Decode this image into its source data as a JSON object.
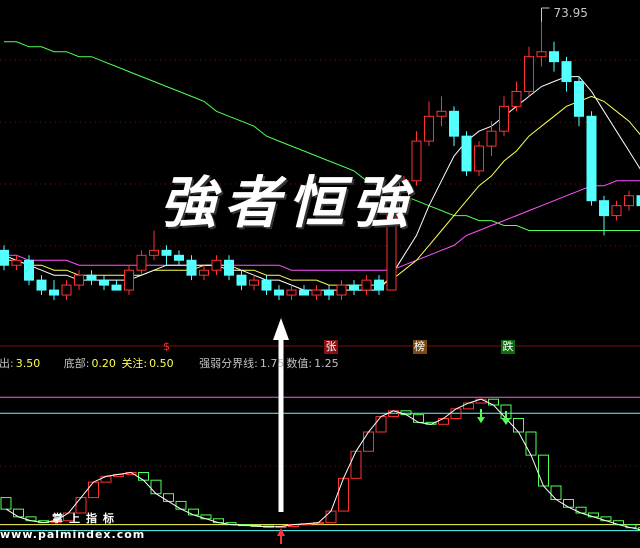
{
  "price_max_label": "73.95",
  "slogan": "強者恒強",
  "badges": {
    "dollar": "$",
    "rise": "张",
    "rank": "榜",
    "fall": "跌"
  },
  "indicator_bar": {
    "sell_label": "卖出:",
    "sell_value": "3.50",
    "bottom_label": "底部:",
    "bottom_value": "0.20",
    "watch_label": "关注:",
    "watch_value": "0.50",
    "boundary_label": "强弱分界线:",
    "boundary_value": "1.75",
    "value_label": "数值:",
    "value_value": "1.25"
  },
  "watermark": {
    "logo": "掌上指标",
    "url": "www.palmindex.com"
  },
  "colors": {
    "up": "#ff3232",
    "down": "#54ffff",
    "ma_white": "#ffffff",
    "ma_yellow": "#ffff54",
    "ma_magenta": "#ff54ff",
    "ma_green": "#54ff54",
    "ind_up": "#ff3232",
    "ind_down": "#54ff54",
    "ind_mid": "#ffffff"
  },
  "chart_data": {
    "type": "candlestick",
    "price_range": [
      18,
      76
    ],
    "candles": [
      {
        "o": 28,
        "c": 25,
        "h": 29,
        "l": 24
      },
      {
        "o": 25,
        "c": 26,
        "h": 27,
        "l": 24
      },
      {
        "o": 26,
        "c": 22,
        "h": 27,
        "l": 21
      },
      {
        "o": 22,
        "c": 20,
        "h": 23,
        "l": 19
      },
      {
        "o": 20,
        "c": 19,
        "h": 22,
        "l": 18
      },
      {
        "o": 19,
        "c": 21,
        "h": 22,
        "l": 18
      },
      {
        "o": 21,
        "c": 23,
        "h": 24,
        "l": 20
      },
      {
        "o": 23,
        "c": 22,
        "h": 24,
        "l": 21
      },
      {
        "o": 22,
        "c": 21,
        "h": 23,
        "l": 20
      },
      {
        "o": 21,
        "c": 20,
        "h": 22,
        "l": 20
      },
      {
        "o": 20,
        "c": 24,
        "h": 25,
        "l": 19
      },
      {
        "o": 24,
        "c": 27,
        "h": 28,
        "l": 23
      },
      {
        "o": 27,
        "c": 28,
        "h": 32,
        "l": 26
      },
      {
        "o": 28,
        "c": 27,
        "h": 29,
        "l": 25
      },
      {
        "o": 27,
        "c": 26,
        "h": 28,
        "l": 25
      },
      {
        "o": 26,
        "c": 23,
        "h": 27,
        "l": 22
      },
      {
        "o": 23,
        "c": 24,
        "h": 25,
        "l": 22
      },
      {
        "o": 24,
        "c": 26,
        "h": 27,
        "l": 23
      },
      {
        "o": 26,
        "c": 23,
        "h": 27,
        "l": 22
      },
      {
        "o": 23,
        "c": 21,
        "h": 24,
        "l": 20
      },
      {
        "o": 21,
        "c": 22,
        "h": 23,
        "l": 20
      },
      {
        "o": 22,
        "c": 20,
        "h": 23,
        "l": 19
      },
      {
        "o": 20,
        "c": 19,
        "h": 21,
        "l": 18
      },
      {
        "o": 19,
        "c": 20,
        "h": 21,
        "l": 18
      },
      {
        "o": 20,
        "c": 19,
        "h": 21,
        "l": 19
      },
      {
        "o": 19,
        "c": 20,
        "h": 21,
        "l": 18
      },
      {
        "o": 20,
        "c": 19,
        "h": 21,
        "l": 18
      },
      {
        "o": 19,
        "c": 21,
        "h": 22,
        "l": 18
      },
      {
        "o": 21,
        "c": 20,
        "h": 22,
        "l": 19
      },
      {
        "o": 20,
        "c": 22,
        "h": 23,
        "l": 19
      },
      {
        "o": 22,
        "c": 20,
        "h": 23,
        "l": 19
      },
      {
        "o": 20,
        "c": 36,
        "h": 37,
        "l": 20
      },
      {
        "o": 36,
        "c": 42,
        "h": 43,
        "l": 35
      },
      {
        "o": 42,
        "c": 50,
        "h": 52,
        "l": 41
      },
      {
        "o": 50,
        "c": 55,
        "h": 58,
        "l": 49
      },
      {
        "o": 55,
        "c": 56,
        "h": 59,
        "l": 53
      },
      {
        "o": 56,
        "c": 51,
        "h": 57,
        "l": 49
      },
      {
        "o": 51,
        "c": 44,
        "h": 52,
        "l": 43
      },
      {
        "o": 44,
        "c": 49,
        "h": 50,
        "l": 43
      },
      {
        "o": 49,
        "c": 52,
        "h": 54,
        "l": 47
      },
      {
        "o": 52,
        "c": 57,
        "h": 59,
        "l": 51
      },
      {
        "o": 57,
        "c": 60,
        "h": 62,
        "l": 56
      },
      {
        "o": 60,
        "c": 67,
        "h": 69,
        "l": 59
      },
      {
        "o": 67,
        "c": 68,
        "h": 74,
        "l": 65
      },
      {
        "o": 68,
        "c": 66,
        "h": 70,
        "l": 64
      },
      {
        "o": 66,
        "c": 62,
        "h": 67,
        "l": 60
      },
      {
        "o": 62,
        "c": 55,
        "h": 63,
        "l": 53
      },
      {
        "o": 55,
        "c": 38,
        "h": 56,
        "l": 37
      },
      {
        "o": 38,
        "c": 35,
        "h": 39,
        "l": 31
      },
      {
        "o": 35,
        "c": 37,
        "h": 38,
        "l": 34
      },
      {
        "o": 37,
        "c": 39,
        "h": 40,
        "l": 36
      },
      {
        "o": 39,
        "c": 37,
        "h": 41,
        "l": 36
      },
      {
        "o": 37,
        "c": 33,
        "h": 38,
        "l": 28
      },
      {
        "o": 33,
        "c": 22,
        "h": 34,
        "l": 21
      },
      {
        "o": 22,
        "c": 25,
        "h": 26,
        "l": 21
      }
    ],
    "ma_white": [
      27,
      26,
      25,
      24,
      23,
      23,
      22,
      22,
      22,
      22,
      22,
      23,
      24,
      25,
      25,
      25,
      25,
      25,
      24,
      24,
      23,
      22,
      22,
      21,
      20,
      20,
      20,
      20,
      20,
      20,
      20,
      23,
      27,
      31,
      37,
      42,
      47,
      50,
      52,
      53,
      55,
      57,
      59,
      61,
      62,
      63,
      63,
      60,
      56,
      52,
      48,
      44,
      40,
      35,
      31
    ],
    "ma_yellow": [
      26,
      26,
      25,
      25,
      24,
      24,
      23,
      23,
      23,
      23,
      23,
      23,
      24,
      24,
      24,
      24,
      25,
      25,
      25,
      24,
      24,
      23,
      23,
      22,
      22,
      22,
      21,
      21,
      21,
      21,
      21,
      22,
      24,
      26,
      29,
      32,
      35,
      38,
      41,
      43,
      46,
      48,
      51,
      53,
      55,
      57,
      58,
      59,
      58,
      56,
      54,
      51,
      48,
      45,
      42
    ],
    "ma_magenta": [
      27,
      27,
      26,
      26,
      26,
      26,
      25,
      25,
      25,
      25,
      25,
      25,
      25,
      25,
      25,
      25,
      25,
      25,
      25,
      25,
      25,
      25,
      25,
      24,
      24,
      24,
      24,
      24,
      24,
      24,
      24,
      24,
      25,
      26,
      27,
      28,
      29,
      31,
      32,
      33,
      34,
      35,
      36,
      37,
      38,
      39,
      40,
      41,
      41,
      42,
      42,
      42,
      42,
      42,
      41
    ],
    "ma_green": [
      70,
      70,
      69,
      69,
      68,
      68,
      67,
      67,
      66,
      65,
      64,
      63,
      62,
      61,
      60,
      59,
      58,
      56,
      55,
      54,
      53,
      51,
      50,
      49,
      48,
      47,
      46,
      45,
      44,
      42,
      41,
      40,
      39,
      38,
      37,
      36,
      35,
      35,
      34,
      34,
      33,
      33,
      32,
      32,
      32,
      32,
      32,
      32,
      32,
      32,
      32,
      32,
      32,
      32,
      32
    ],
    "indicator_range": [
      -0.2,
      4.0
    ],
    "indicator_levels": {
      "sell": 3.5,
      "bottom": 0.2,
      "watch": 0.5,
      "boundary": 1.75,
      "value": 1.25
    },
    "indicator_bars": [
      {
        "o": 0.9,
        "c": 0.6
      },
      {
        "o": 0.6,
        "c": 0.4
      },
      {
        "o": 0.4,
        "c": 0.3
      },
      {
        "o": 0.3,
        "c": 0.25
      },
      {
        "o": 0.25,
        "c": 0.3
      },
      {
        "o": 0.3,
        "c": 0.5
      },
      {
        "o": 0.5,
        "c": 0.9
      },
      {
        "o": 0.9,
        "c": 1.3
      },
      {
        "o": 1.3,
        "c": 1.45
      },
      {
        "o": 1.45,
        "c": 1.5
      },
      {
        "o": 1.5,
        "c": 1.55
      },
      {
        "o": 1.55,
        "c": 1.35
      },
      {
        "o": 1.35,
        "c": 1.0
      },
      {
        "o": 1.0,
        "c": 0.8
      },
      {
        "o": 0.8,
        "c": 0.6
      },
      {
        "o": 0.6,
        "c": 0.45
      },
      {
        "o": 0.45,
        "c": 0.35
      },
      {
        "o": 0.35,
        "c": 0.25
      },
      {
        "o": 0.25,
        "c": 0.2
      },
      {
        "o": 0.2,
        "c": 0.18
      },
      {
        "o": 0.18,
        "c": 0.16
      },
      {
        "o": 0.16,
        "c": 0.14
      },
      {
        "o": 0.14,
        "c": 0.15
      },
      {
        "o": 0.15,
        "c": 0.2
      },
      {
        "o": 0.2,
        "c": 0.22
      },
      {
        "o": 0.22,
        "c": 0.25
      },
      {
        "o": 0.25,
        "c": 0.55
      },
      {
        "o": 0.55,
        "c": 1.4
      },
      {
        "o": 1.4,
        "c": 2.1
      },
      {
        "o": 2.1,
        "c": 2.6
      },
      {
        "o": 2.6,
        "c": 3.0
      },
      {
        "o": 3.0,
        "c": 3.15
      },
      {
        "o": 3.15,
        "c": 3.05
      },
      {
        "o": 3.05,
        "c": 2.85
      },
      {
        "o": 2.85,
        "c": 2.8
      },
      {
        "o": 2.8,
        "c": 2.95
      },
      {
        "o": 2.95,
        "c": 3.2
      },
      {
        "o": 3.2,
        "c": 3.35
      },
      {
        "o": 3.35,
        "c": 3.45
      },
      {
        "o": 3.45,
        "c": 3.3
      },
      {
        "o": 3.3,
        "c": 2.95
      },
      {
        "o": 2.95,
        "c": 2.6
      },
      {
        "o": 2.6,
        "c": 2.0
      },
      {
        "o": 2.0,
        "c": 1.2
      },
      {
        "o": 1.2,
        "c": 0.85
      },
      {
        "o": 0.85,
        "c": 0.65
      },
      {
        "o": 0.65,
        "c": 0.5
      },
      {
        "o": 0.5,
        "c": 0.4
      },
      {
        "o": 0.4,
        "c": 0.3
      },
      {
        "o": 0.3,
        "c": 0.2
      },
      {
        "o": 0.2,
        "c": 0.12
      },
      {
        "o": 0.12,
        "c": 0.05
      }
    ],
    "signals": {
      "buy_index": 22,
      "sell_indices": [
        38,
        40
      ],
      "badge_dollar_index": 13,
      "badge_rise_index": 26,
      "badge_rank_index": 33,
      "badge_fall_index": 40
    }
  }
}
